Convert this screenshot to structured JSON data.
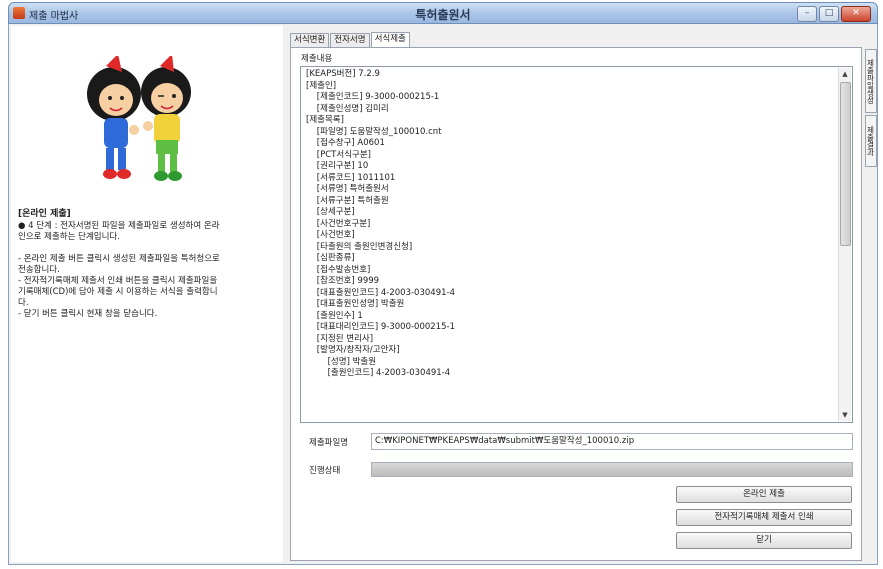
{
  "titlebar": {
    "app_title": "제출 마법사",
    "window_title": "특허출원서",
    "minimize": "–",
    "maximize": "□",
    "close": "✕"
  },
  "help": {
    "title": "[온라인 제출]",
    "text": "● 4 단계 : 전자서명된 파일을 제출파일로 생성하여 온라\n인으로 제출하는 단계입니다.\n\n- 온라인 제출 버튼 클릭시 생성된 제출파일을 특허청으로\n전송합니다.\n- 전자적기록매체 제출서 인쇄 버튼을 클릭시 제출파일을\n기록매체(CD)에 담아 제출 시 이용하는 서식을 출력합니\n다.\n- 닫기 버튼 클릭시 현재 창을 닫습니다."
  },
  "tabs": [
    "서식변환",
    "전자서명",
    "서식제출"
  ],
  "active_tab": "서식제출",
  "side_tabs": [
    "제출파일생성",
    "제출결과"
  ],
  "section_label": "제출내용",
  "content_lines": [
    "[KEAPS버전] 7.2.9",
    "[제출인]",
    "    [제출인코드] 9-3000-000215-1",
    "    [제출인성명] 김미리",
    "[제출목록]",
    "    [파일명] 도움말작성_100010.cnt",
    "    [접수창구] A0601",
    "    [PCT서식구분]",
    "    [권리구분] 10",
    "    [서류코드] 1011101",
    "    [서류명] 특허출원서",
    "    [서류구분] 특허출원",
    "    [상세구분]",
    "    [사건번호구분]",
    "    [사건번호]",
    "    [타출원의 출원인변경신청]",
    "    [심판종류]",
    "    [접수발송번호]",
    "    [참조번호] 9999",
    "    [대표출원인코드] 4-2003-030491-4",
    "    [대표출원인성명] 박출원",
    "    [출원인수] 1",
    "    [대표대리인코드] 9-3000-000215-1",
    "    [지정된 변리사]",
    "    [발명자/창작자/고안자]",
    "        [성명] 박출원",
    "        [출원인코드] 4-2003-030491-4"
  ],
  "file": {
    "label": "제출파일명",
    "value": "C:₩KIPONET₩PKEAPS₩data₩submit₩도움말작성_100010.zip"
  },
  "progress": {
    "label": "진행상태",
    "value": 0
  },
  "buttons": {
    "submit_online": "온라인 제출",
    "print_media": "전자적기록매체 제출서 인쇄",
    "close": "닫기"
  }
}
